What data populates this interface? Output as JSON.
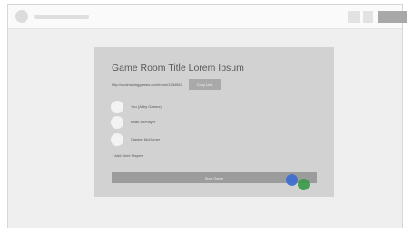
{
  "room": {
    "title": "Game Room Title Lorem Ipsum",
    "link": "http://coolmakinggames.com/room/1234567",
    "copy_label": "Copy Link"
  },
  "players": [
    {
      "name": "You (Abby Gamez)"
    },
    {
      "name": "Brian McPlayer"
    },
    {
      "name": "Clayton McGamer"
    }
  ],
  "add_players_label": "+ Add More Players",
  "start_label": "Start Game"
}
